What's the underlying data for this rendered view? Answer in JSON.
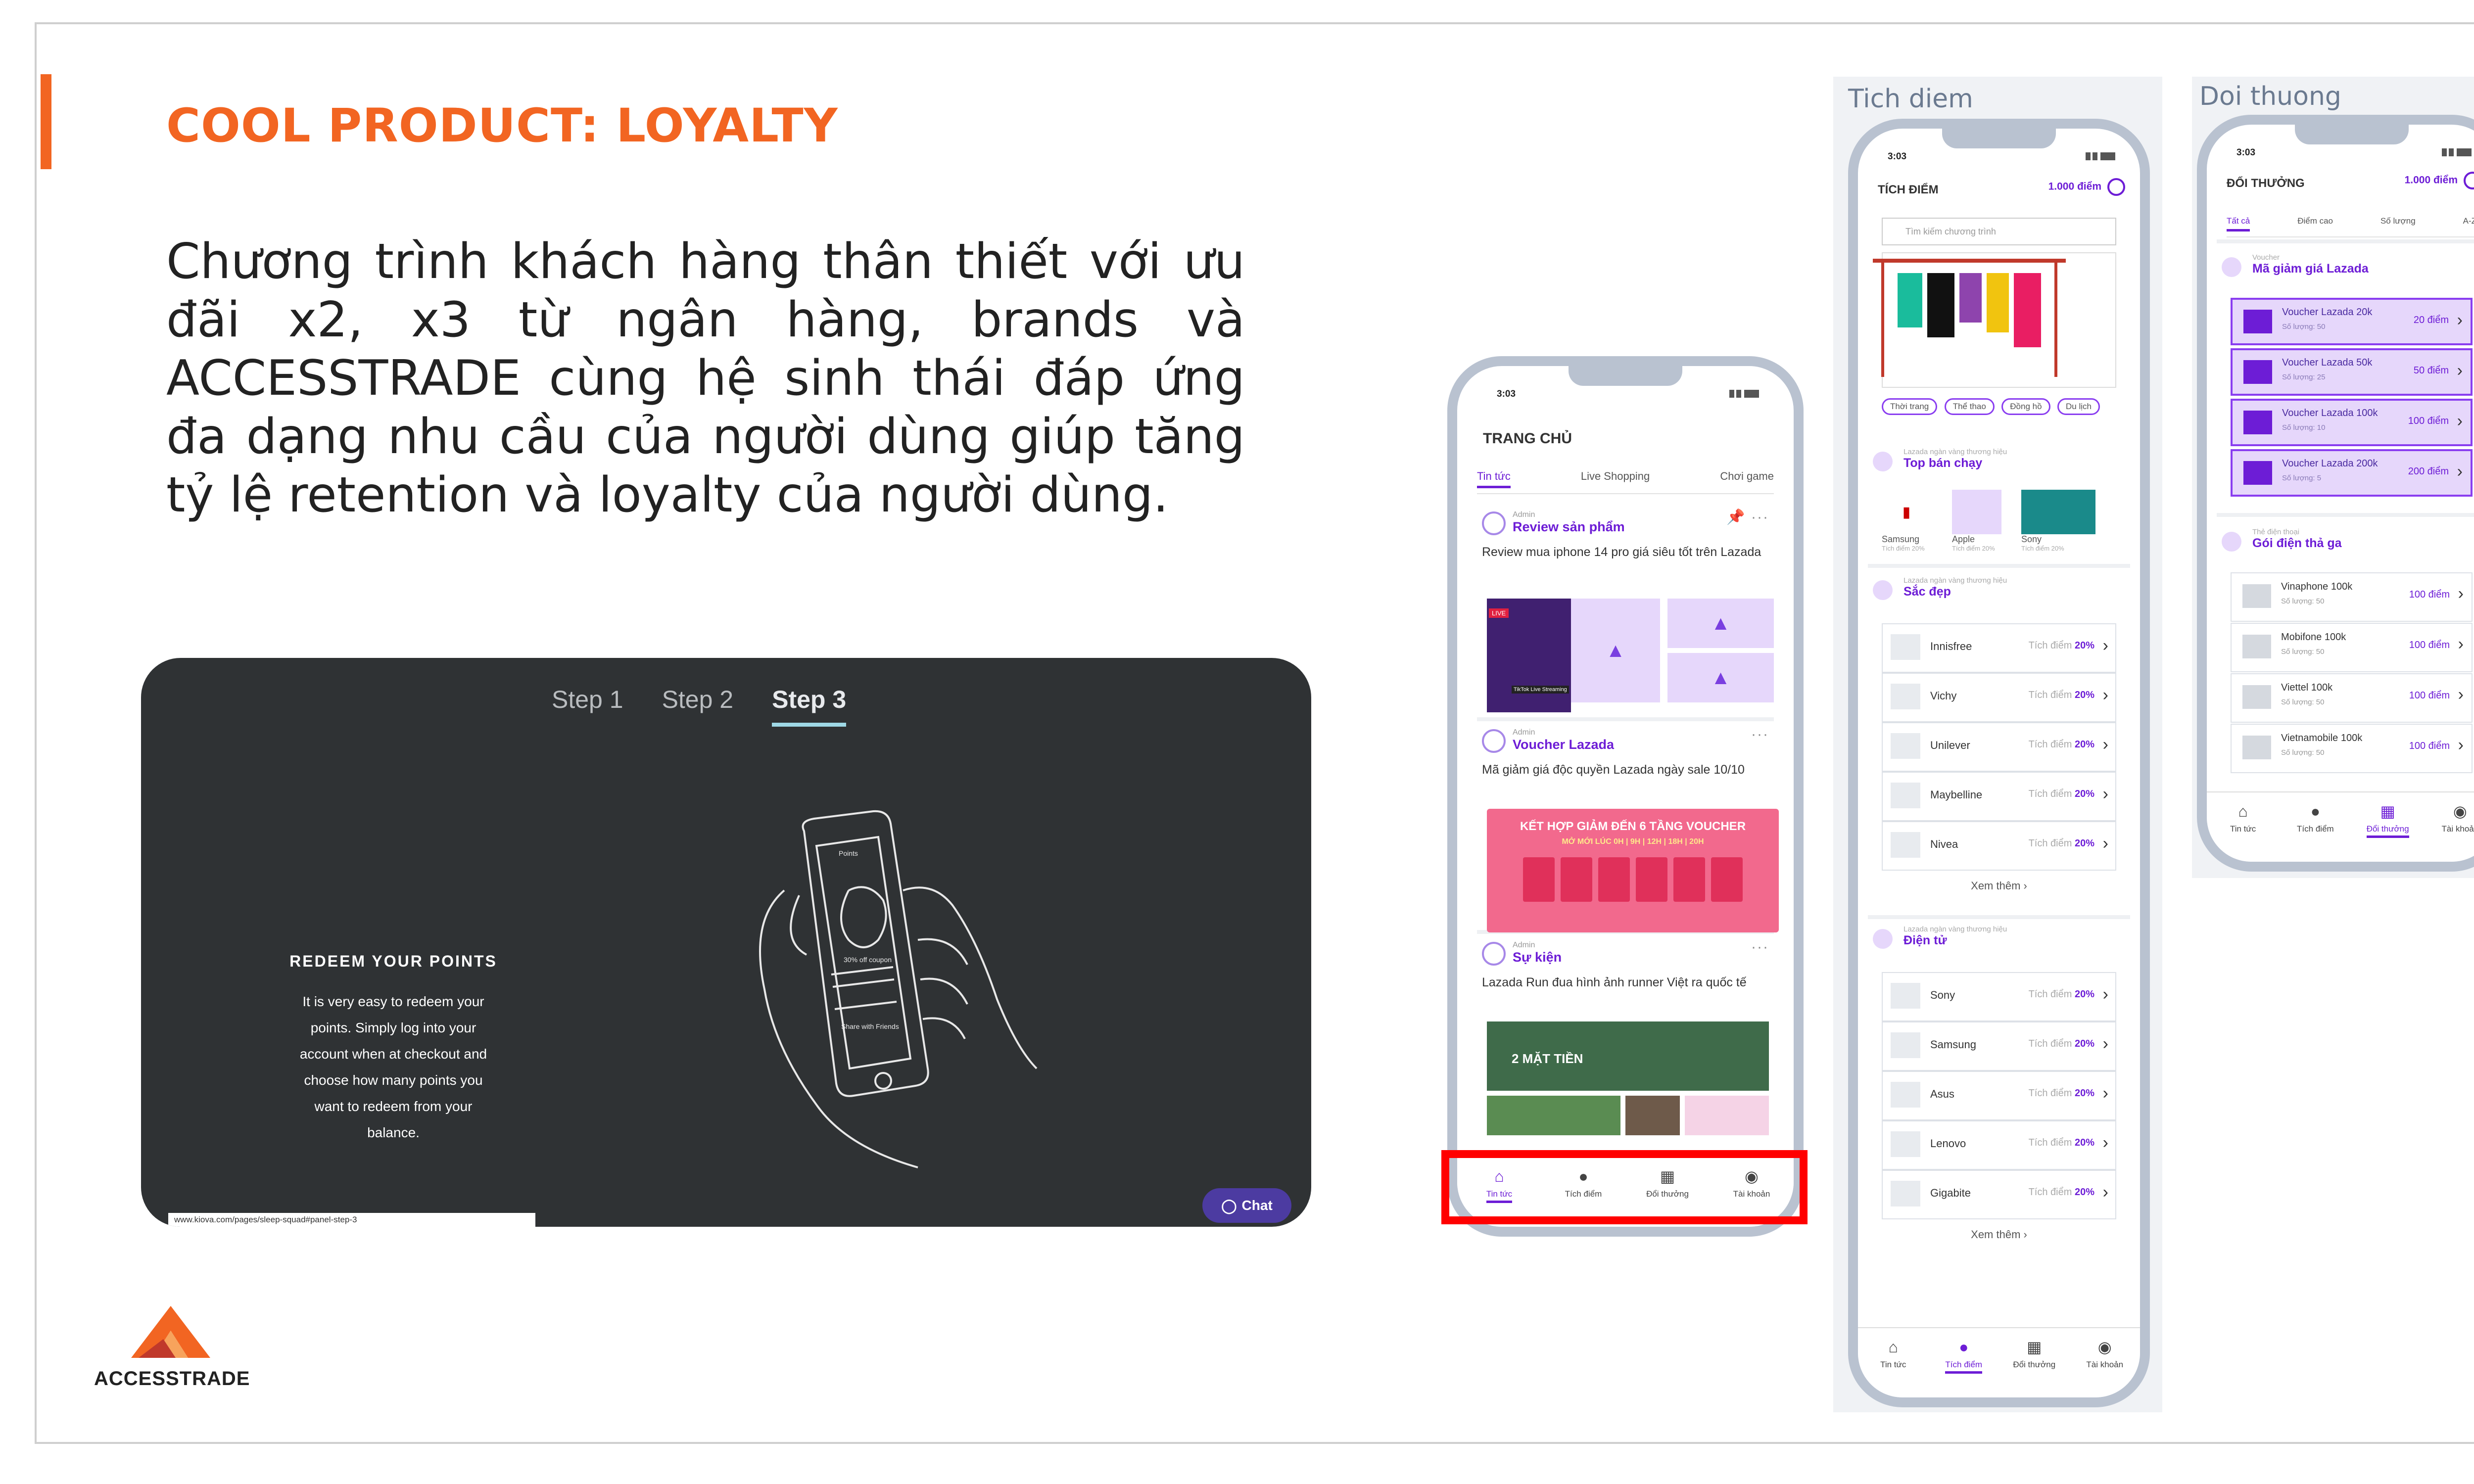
{
  "slide": {
    "title": "COOL PRODUCT: LOYALTY",
    "body": "Chương trình khách hàng thân thiết với ưu đãi x2, x3 từ ngân hàng, brands và ACCESSTRADE cùng hệ sinh thái đáp ứng đa dạng nhu cầu của người dùng giúp tăng tỷ lệ retention và loyalty của người dùng.",
    "logo_text": "ACCESSTRADE",
    "accent_color": "#f26522"
  },
  "kiova": {
    "steps": [
      "Step 1",
      "Step 2",
      "Step 3"
    ],
    "active_step": "Step 3",
    "redeem_title": "REDEEM YOUR POINTS",
    "redeem_body": "It is very easy to redeem your points. Simply log into your account when at checkout and choose how many points you want to redeem from your balance.",
    "chat_label": "Chat",
    "url": "www.kiova.com/pages/sleep-squad#panel-step-3",
    "phone_screen": {
      "line1": "Points",
      "line2": "30% off coupon",
      "line3": "Share with Friends"
    }
  },
  "phone_home": {
    "time": "3:03",
    "title": "TRANG CHỦ",
    "tabs": [
      "Tin tức",
      "Live Shopping",
      "Chơi game"
    ],
    "posts": [
      {
        "author": "Admin",
        "category": "Review sản phẩm",
        "text": "Review mua iphone 14 pro giá siêu tốt trên Lazada",
        "badge_live": "LIVE",
        "badge_stream": "TikTok Live Streaming"
      },
      {
        "author": "Admin",
        "category": "Voucher Lazada",
        "text": "Mã giảm giá độc quyền Lazada ngày sale 10/10",
        "banner_title": "KẾT HỢP GIẢM ĐẾN 6 TẦNG VOUCHER",
        "banner_sub": "MỞ MỚI LÚC 0H | 9H | 12H | 18H | 20H"
      },
      {
        "author": "Admin",
        "category": "Sự kiện",
        "text": "Lazada Run đua hình ảnh runner Việt ra quốc tế",
        "banner_text": "2 MẶT TIỀN"
      }
    ],
    "tabbar": [
      "Tin tức",
      "Tích điểm",
      "Đổi thưởng",
      "Tài khoản"
    ]
  },
  "phone_tich": {
    "caption": "Tich diem",
    "time": "3:03",
    "title": "TÍCH ĐIỂM",
    "points": "1.000 điểm",
    "search_placeholder": "Tìm kiếm chương trình",
    "chips": [
      "Thời trang",
      "Thể thao",
      "Đồng hồ",
      "Du lịch"
    ],
    "top_seller_label": "Lazada ngàn vàng thương hiệu",
    "top_seller_name": "Top bán chạy",
    "top_items": [
      {
        "name": "Samsung",
        "rate": "Tích điểm 20%"
      },
      {
        "name": "Apple",
        "rate": "Tích điểm 20%"
      },
      {
        "name": "Sony",
        "rate": "Tích điểm 20%"
      }
    ],
    "sections": [
      {
        "small": "Lazada ngàn vàng thương hiệu",
        "name": "Sắc đẹp",
        "rows": [
          "Innisfree",
          "Vichy",
          "Unilever",
          "Maybelline",
          "Nivea"
        ]
      },
      {
        "small": "Lazada ngàn vàng thương hiệu",
        "name": "Điện tử",
        "rows": [
          "Sony",
          "Samsung",
          "Asus",
          "Lenovo",
          "Gigabite"
        ]
      }
    ],
    "row_rate_label": "Tích điểm",
    "row_rate_value": "20%",
    "more": "Xem thêm",
    "tabbar": [
      "Tin tức",
      "Tích điểm",
      "Đổi thưởng",
      "Tài khoản"
    ]
  },
  "phone_doi": {
    "caption": "Doi thuong",
    "time": "3:03",
    "title": "ĐỔI THƯỞNG",
    "points": "1.000 điểm",
    "tabs": [
      "Tất cả",
      "Điểm cao",
      "Số lượng",
      "A-Z"
    ],
    "voucher_small": "Voucher",
    "voucher_name": "Mã giảm giá Lazada",
    "vouchers": [
      {
        "name": "Voucher Lazada 20k",
        "sub": "Số lượng: 50",
        "pts": "20 điểm"
      },
      {
        "name": "Voucher Lazada 50k",
        "sub": "Số lượng: 25",
        "pts": "50 điểm"
      },
      {
        "name": "Voucher Lazada 100k",
        "sub": "Số lượng: 10",
        "pts": "100 điểm"
      },
      {
        "name": "Voucher Lazada 200k",
        "sub": "Số lượng: 5",
        "pts": "200 điểm"
      }
    ],
    "card_small": "Thẻ điện thoại",
    "card_name": "Gói điện thả ga",
    "cards": [
      {
        "name": "Vinaphone 100k",
        "sub": "Số lượng: 50",
        "pts": "100 điểm"
      },
      {
        "name": "Mobifone 100k",
        "sub": "Số lượng: 50",
        "pts": "100 điểm"
      },
      {
        "name": "Viettel 100k",
        "sub": "Số lượng: 50",
        "pts": "100 điểm"
      },
      {
        "name": "Vietnamobile 100k",
        "sub": "Số lượng: 50",
        "pts": "100 điểm"
      }
    ],
    "tabbar": [
      "Tin tức",
      "Tích điểm",
      "Đổi thưởng",
      "Tài khoản"
    ]
  }
}
